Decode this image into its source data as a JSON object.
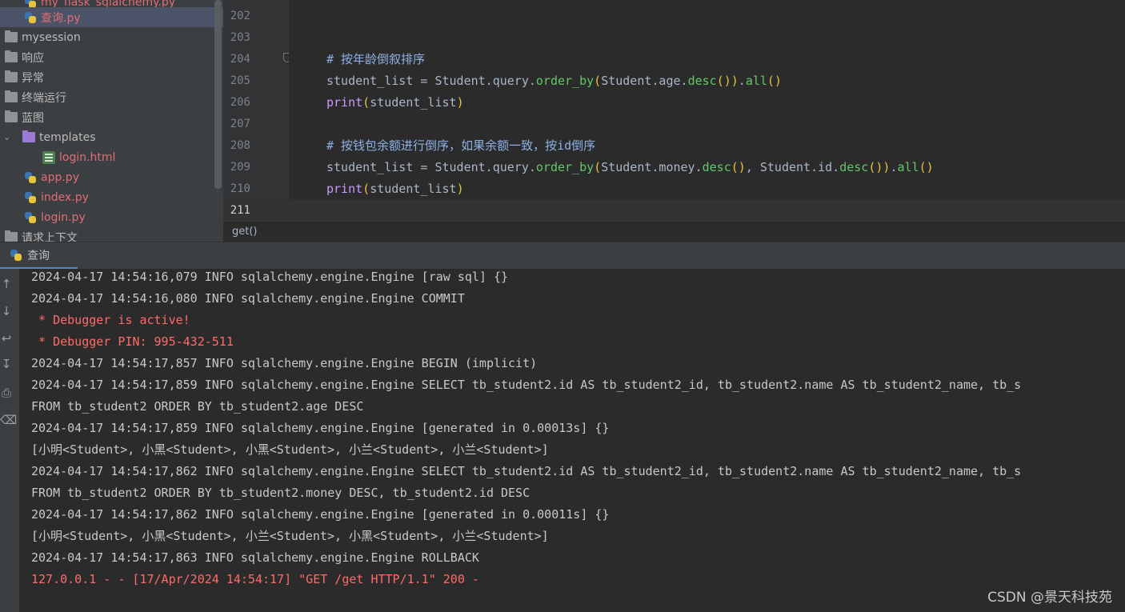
{
  "project_tree": {
    "items": [
      {
        "label": "my_flask_sqlalchemy.py",
        "type": "python-file"
      },
      {
        "label": "查询.py",
        "type": "python-file",
        "selected": true
      },
      {
        "label": "mysession",
        "type": "folder"
      },
      {
        "label": "响应",
        "type": "folder"
      },
      {
        "label": "异常",
        "type": "folder"
      },
      {
        "label": "终端运行",
        "type": "folder"
      },
      {
        "label": "蓝图",
        "type": "folder"
      },
      {
        "label": "templates",
        "type": "template-folder",
        "expanded": true
      },
      {
        "label": "login.html",
        "type": "html-file"
      },
      {
        "label": "app.py",
        "type": "python-file"
      },
      {
        "label": "index.py",
        "type": "python-file"
      },
      {
        "label": "login.py",
        "type": "python-file"
      },
      {
        "label": "请求上下文",
        "type": "folder"
      }
    ]
  },
  "editor": {
    "line_numbers": [
      "202",
      "203",
      "204",
      "205",
      "206",
      "207",
      "208",
      "209",
      "210",
      "211"
    ],
    "current_line": "211",
    "lines": {
      "l204": {
        "comment": "# 按年龄倒叙排序"
      },
      "l205": {
        "a": "student_list = Student.query.",
        "b": "order_by",
        "c": "(",
        "d": "Student.age.",
        "e": "desc",
        "f": "())",
        "g": ".",
        "h": "all",
        "i": "()"
      },
      "l206": {
        "a": "print",
        "b": "(",
        "c": "student_list",
        "d": ")"
      },
      "l208": {
        "comment": "# 按钱包余额进行倒序，如果余额一致，按id倒序"
      },
      "l209": {
        "a": "student_list = Student.query.",
        "b": "order_by",
        "c": "(",
        "d": "Student.money.",
        "e": "desc",
        "f": "()",
        "g": ", Student.id.",
        "h": "desc",
        "i": "())",
        "j": ".",
        "k": "all",
        "l": "()"
      },
      "l210": {
        "a": "print",
        "b": "(",
        "c": "student_list",
        "d": ")"
      }
    },
    "breadcrumb": "get()"
  },
  "run_window": {
    "tab_label": "查询",
    "toolbar_icons": [
      "arrow-up-icon",
      "arrow-down-icon",
      "soft-wrap-icon",
      "scroll-to-end-icon",
      "print-icon",
      "trash-icon"
    ],
    "console_lines": [
      {
        "text": "2024-04-17 14:54:16,079 INFO sqlalchemy.engine.Engine [raw sql] {}",
        "kind": "info"
      },
      {
        "text": "2024-04-17 14:54:16,080 INFO sqlalchemy.engine.Engine COMMIT",
        "kind": "info"
      },
      {
        "text": " * Debugger is active!",
        "kind": "err"
      },
      {
        "text": " * Debugger PIN: 995-432-511",
        "kind": "err"
      },
      {
        "text": "2024-04-17 14:54:17,857 INFO sqlalchemy.engine.Engine BEGIN (implicit)",
        "kind": "info"
      },
      {
        "text": "2024-04-17 14:54:17,859 INFO sqlalchemy.engine.Engine SELECT tb_student2.id AS tb_student2_id, tb_student2.name AS tb_student2_name, tb_s",
        "kind": "info"
      },
      {
        "text": "FROM tb_student2 ORDER BY tb_student2.age DESC",
        "kind": "info"
      },
      {
        "text": "2024-04-17 14:54:17,859 INFO sqlalchemy.engine.Engine [generated in 0.00013s] {}",
        "kind": "info"
      },
      {
        "text": "[小明<Student>, 小黑<Student>, 小黑<Student>, 小兰<Student>, 小兰<Student>]",
        "kind": "info"
      },
      {
        "text": "2024-04-17 14:54:17,862 INFO sqlalchemy.engine.Engine SELECT tb_student2.id AS tb_student2_id, tb_student2.name AS tb_student2_name, tb_s",
        "kind": "info"
      },
      {
        "text": "FROM tb_student2 ORDER BY tb_student2.money DESC, tb_student2.id DESC",
        "kind": "info"
      },
      {
        "text": "2024-04-17 14:54:17,862 INFO sqlalchemy.engine.Engine [generated in 0.00011s] {}",
        "kind": "info"
      },
      {
        "text": "[小明<Student>, 小黑<Student>, 小兰<Student>, 小黑<Student>, 小兰<Student>]",
        "kind": "info"
      },
      {
        "text": "2024-04-17 14:54:17,863 INFO sqlalchemy.engine.Engine ROLLBACK",
        "kind": "info"
      },
      {
        "text": "127.0.0.1 - - [17/Apr/2024 14:54:17] \"GET /get HTTP/1.1\" 200 -",
        "kind": "err"
      }
    ]
  },
  "watermark": "CSDN @景天科技苑"
}
